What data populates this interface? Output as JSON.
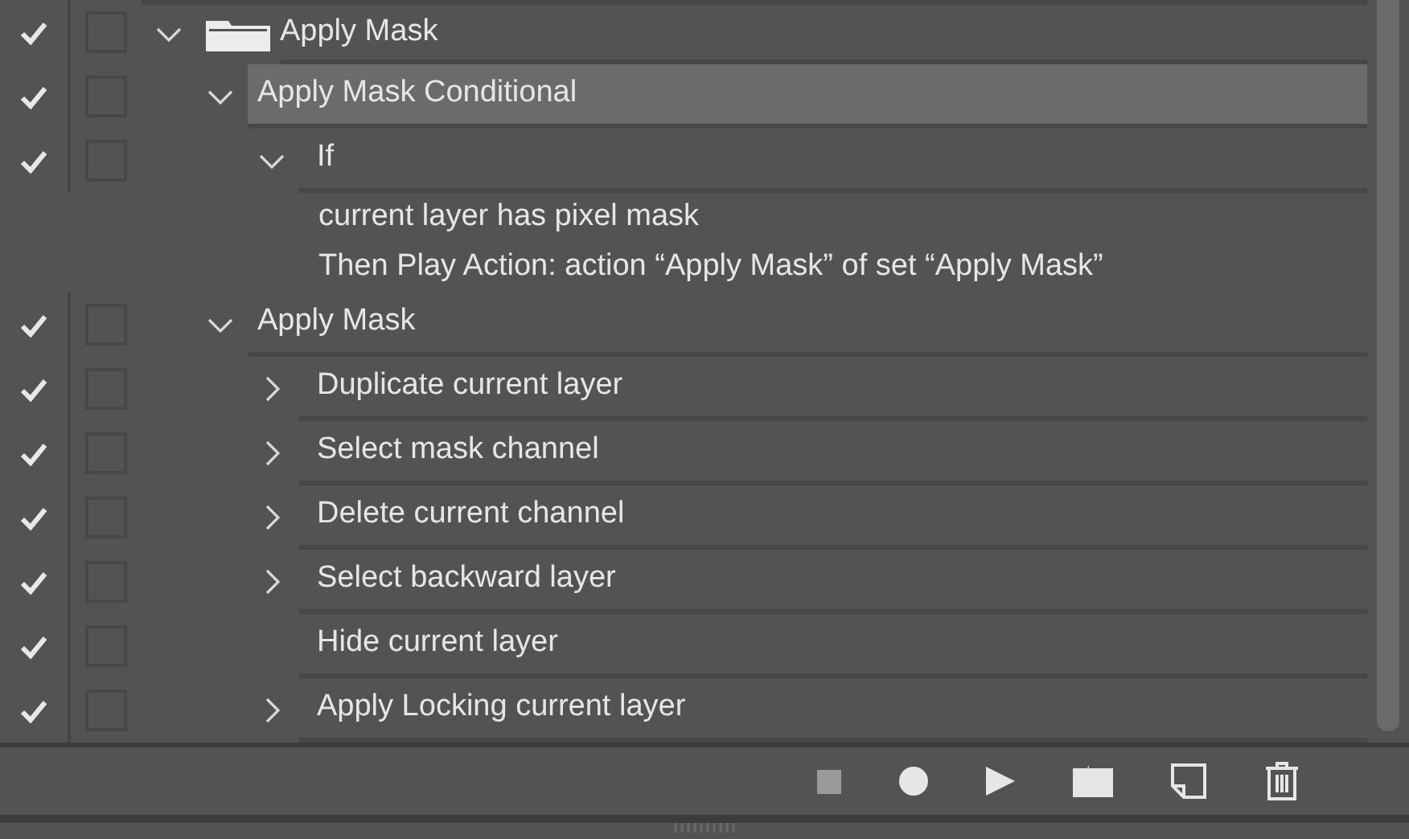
{
  "items": [
    {
      "kind": "set",
      "label": "Apply Mask",
      "checked": true,
      "dialog": false,
      "expanded": true,
      "selected": false,
      "children": [
        {
          "kind": "action",
          "label": "Apply Mask Conditional",
          "checked": true,
          "dialog": false,
          "expanded": true,
          "selected": true,
          "children": [
            {
              "kind": "command",
              "label": "If",
              "checked": true,
              "dialog": false,
              "expandable": true,
              "expanded": true,
              "selected": false,
              "details": [
                "current layer has pixel mask",
                "Then Play Action: action “Apply Mask” of set “Apply Mask”"
              ]
            }
          ]
        },
        {
          "kind": "action",
          "label": "Apply Mask",
          "checked": true,
          "dialog": false,
          "expanded": true,
          "selected": false,
          "children": [
            {
              "kind": "command",
              "label": "Duplicate current layer",
              "checked": true,
              "dialog": false,
              "expandable": true,
              "expanded": false,
              "selected": false
            },
            {
              "kind": "command",
              "label": "Select mask channel",
              "checked": true,
              "dialog": false,
              "expandable": true,
              "expanded": false,
              "selected": false
            },
            {
              "kind": "command",
              "label": "Delete current channel",
              "checked": true,
              "dialog": false,
              "expandable": true,
              "expanded": false,
              "selected": false
            },
            {
              "kind": "command",
              "label": "Select backward layer",
              "checked": true,
              "dialog": false,
              "expandable": true,
              "expanded": false,
              "selected": false
            },
            {
              "kind": "command",
              "label": "Hide current layer",
              "checked": true,
              "dialog": false,
              "expandable": false,
              "expanded": false,
              "selected": false
            },
            {
              "kind": "command",
              "label": "Apply Locking current layer",
              "checked": true,
              "dialog": false,
              "expandable": true,
              "expanded": false,
              "selected": false
            }
          ]
        }
      ]
    }
  ]
}
